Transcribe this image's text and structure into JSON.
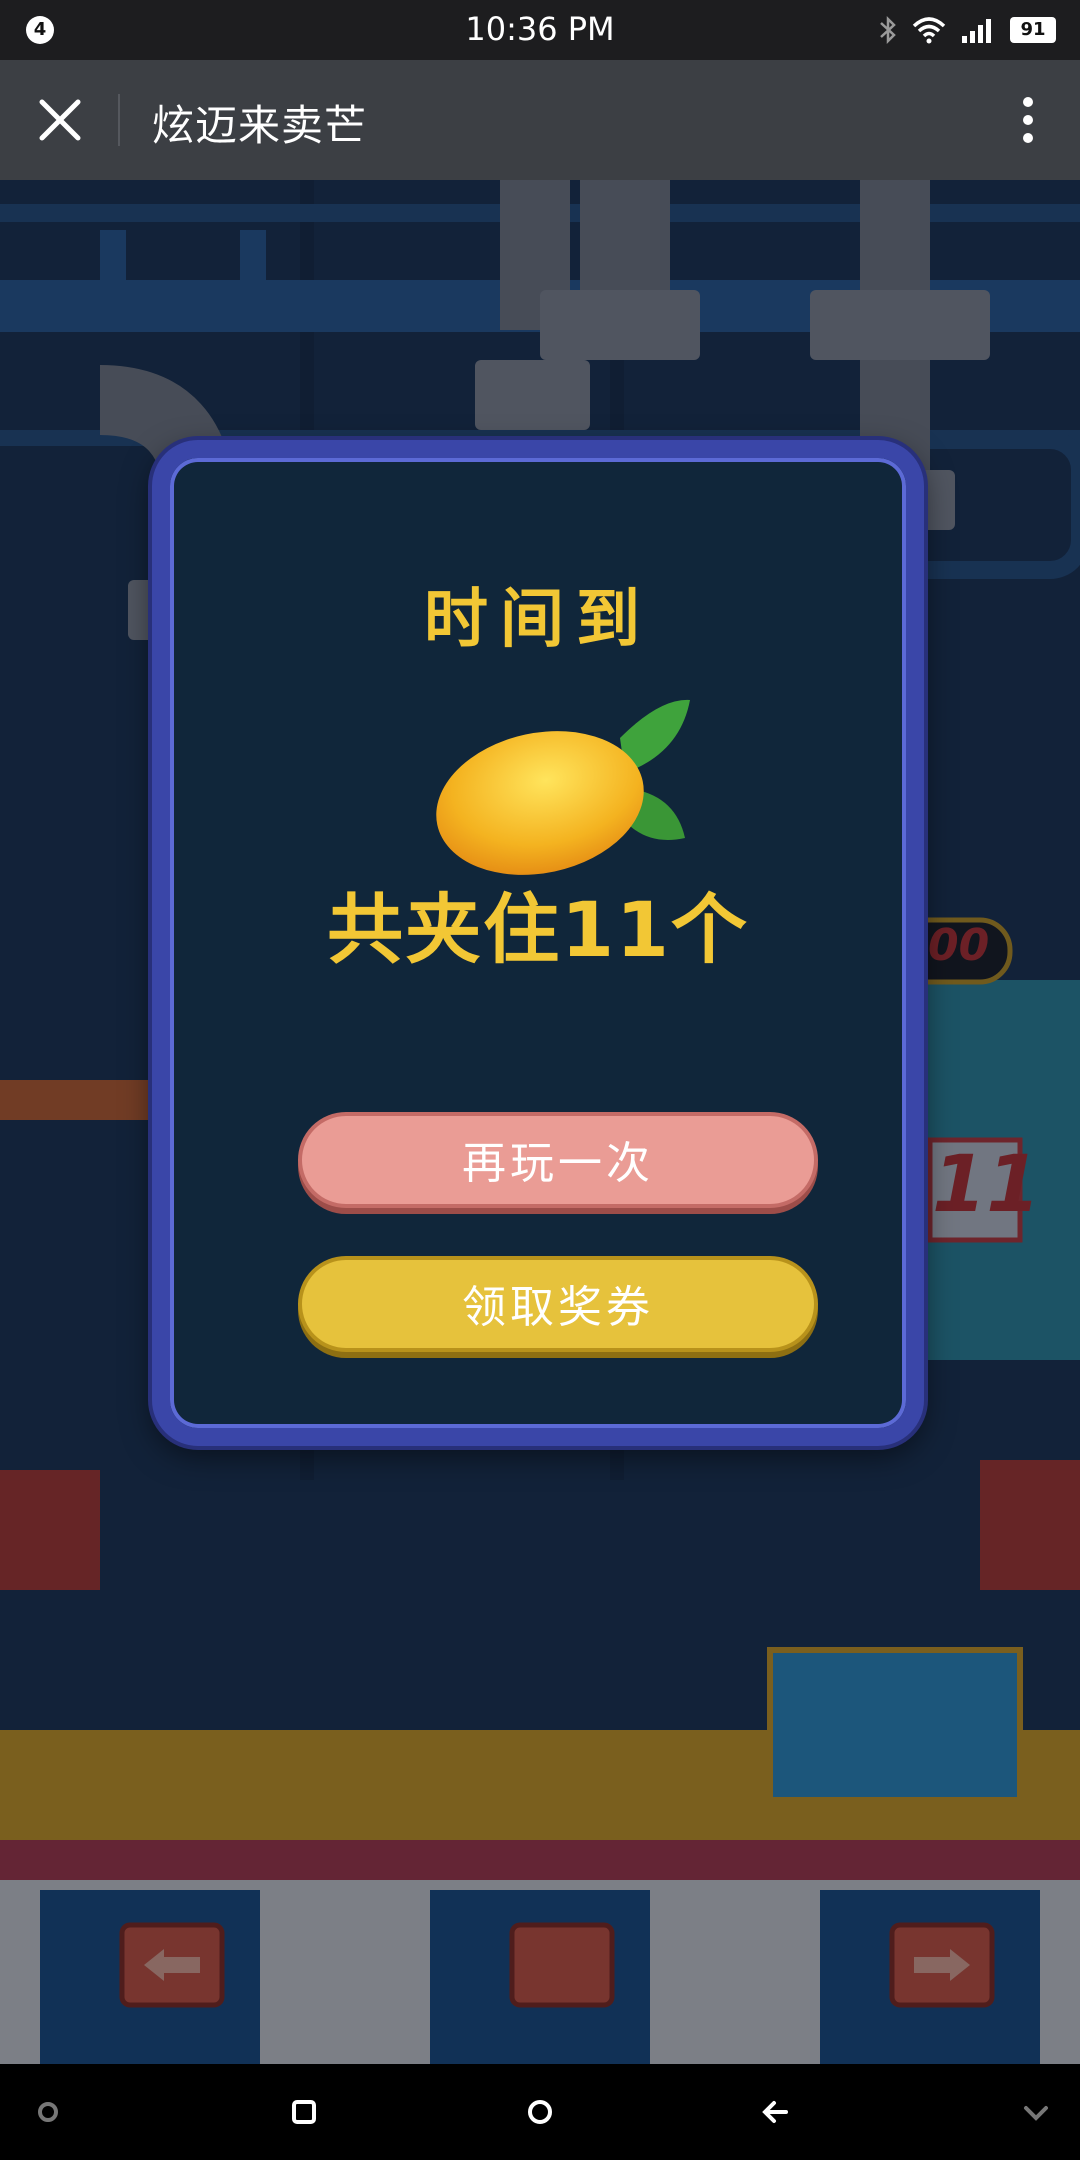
{
  "status_bar": {
    "notification_count": "4",
    "time": "10:36 PM",
    "battery": "91",
    "icons": [
      "bluetooth-icon",
      "wifi-icon",
      "signal-icon",
      "battery-icon"
    ]
  },
  "title_bar": {
    "title": "炫迈来卖芒",
    "icons": [
      "close-icon",
      "more-vertical-icon"
    ]
  },
  "game": {
    "background_scoreboard": {
      "timer": "00",
      "count": "11"
    }
  },
  "modal": {
    "heading": "时间到",
    "result_text": "共夹住11个",
    "icon": "mango-icon",
    "buttons": {
      "replay": "再玩一次",
      "claim": "领取奖券"
    },
    "colors": {
      "heading": "#f2c735",
      "frame": "#3a46a8",
      "replay_button": "#ea9c95",
      "claim_button": "#e6c23c"
    }
  },
  "nav_bar": {
    "icons": [
      "settings-icon",
      "recents-icon",
      "home-icon",
      "back-icon",
      "collapse-icon"
    ]
  }
}
